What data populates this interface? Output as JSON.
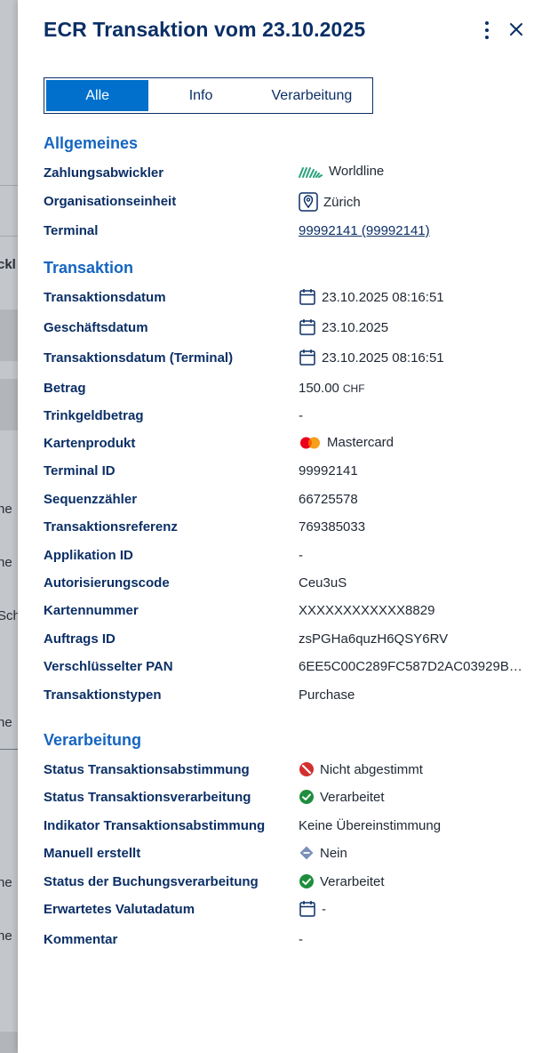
{
  "backdrop": {
    "fragments": [
      "ckl",
      "ne",
      "ne",
      "Sch",
      "ne",
      "ne",
      "ne"
    ]
  },
  "panel": {
    "title": "ECR Transaktion vom 23.10.2025",
    "tabs": [
      {
        "label": "Alle",
        "active": true
      },
      {
        "label": "Info",
        "active": false
      },
      {
        "label": "Verarbeitung",
        "active": false
      }
    ]
  },
  "sections": {
    "allgemeines": {
      "heading": "Allgemeines",
      "rows": [
        {
          "label": "Zahlungsabwickler",
          "value": "Worldline",
          "icon": "worldline-logo"
        },
        {
          "label": "Organisationseinheit",
          "value": "Zürich",
          "icon": "map-pin-icon"
        },
        {
          "label": "Terminal",
          "value": "99992141 (99992141)",
          "link": true
        }
      ]
    },
    "transaktion": {
      "heading": "Transaktion",
      "rows": [
        {
          "label": "Transaktionsdatum",
          "value": "23.10.2025 08:16:51",
          "icon": "calendar-icon"
        },
        {
          "label": "Geschäftsdatum",
          "value": "23.10.2025",
          "icon": "calendar-icon"
        },
        {
          "label": "Transaktionsdatum (Terminal)",
          "value": "23.10.2025 08:16:51",
          "icon": "calendar-icon"
        },
        {
          "label": "Betrag",
          "value": "150.00",
          "unit": "CHF"
        },
        {
          "label": "Trinkgeldbetrag",
          "value": "-"
        },
        {
          "label": "Kartenprodukt",
          "value": "Mastercard",
          "icon": "mastercard-logo"
        },
        {
          "label": "Terminal ID",
          "value": "99992141"
        },
        {
          "label": "Sequenzzähler",
          "value": "66725578"
        },
        {
          "label": "Transaktionsreferenz",
          "value": "769385033"
        },
        {
          "label": "Applikation ID",
          "value": "-"
        },
        {
          "label": "Autorisierungscode",
          "value": "Ceu3uS"
        },
        {
          "label": "Kartennummer",
          "value": "XXXXXXXXXXXX8829"
        },
        {
          "label": "Auftrags ID",
          "value": "zsPGHa6quzH6QSY6RV"
        },
        {
          "label": "Verschlüsselter PAN",
          "value": "6EE5C00C289FC587D2AC03929B66..."
        },
        {
          "label": "Transaktionstypen",
          "value": "Purchase"
        }
      ]
    },
    "verarbeitung": {
      "heading": "Verarbeitung",
      "rows": [
        {
          "label": "Status Transaktionsabstimmung",
          "value": "Nicht abgestimmt",
          "icon": "not-reconciled-icon"
        },
        {
          "label": "Status Transaktionsverarbeitung",
          "value": "Verarbeitet",
          "icon": "check-circle-icon"
        },
        {
          "label": "Indikator Transaktionsabstimmung",
          "value": "Keine Übereinstimmung"
        },
        {
          "label": "Manuell erstellt",
          "value": "Nein",
          "icon": "diamond-icon"
        },
        {
          "label": "Status der Buchungsverarbeitung",
          "value": "Verarbeitet",
          "icon": "check-circle-icon"
        },
        {
          "label": "Erwartetes Valutadatum",
          "value": "-",
          "icon": "calendar-icon"
        },
        {
          "label": "Kommentar",
          "value": "-"
        }
      ]
    }
  },
  "colors": {
    "title": "#0b2f66",
    "section": "#1565c0",
    "tab_active": "#0070cc",
    "success": "#1e8e3e",
    "danger": "#d32f2f"
  }
}
